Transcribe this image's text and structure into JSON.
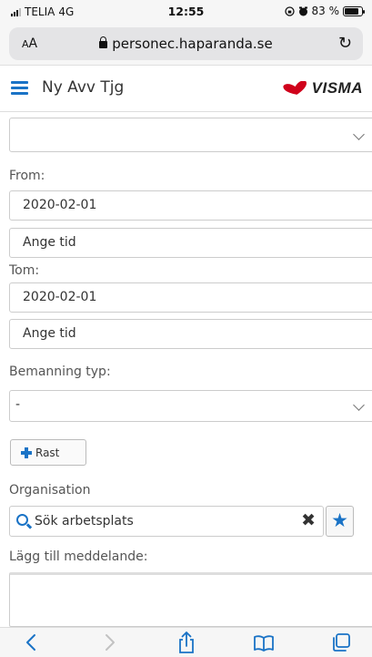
{
  "status_bar": {
    "carrier": "TELIA",
    "network": "4G",
    "time": "12:55",
    "battery_text": "83 %",
    "battery_level": 0.83
  },
  "browser": {
    "text_size_label_small": "A",
    "text_size_label_large": "A",
    "url": "personec.haparanda.se",
    "icons": [
      "lock-icon",
      "reload-icon",
      "back-icon",
      "forward-icon",
      "share-icon",
      "bookmarks-icon",
      "tabs-icon"
    ]
  },
  "header": {
    "title": "Ny Avv Tjg",
    "brand": "VISMA",
    "brand_color": "#d0021b",
    "accent_color": "#1a73c6"
  },
  "form": {
    "type_select_value": "",
    "from_label": "From:",
    "from_date": "2020-02-01",
    "from_time_placeholder": "Ange tid",
    "tom_label": "Tom:",
    "tom_date": "2020-02-01",
    "tom_time_placeholder": "Ange tid",
    "staffing_label": "Bemanning typ:",
    "staffing_value": "-",
    "break_button": "Rast",
    "org_label": "Organisation",
    "org_search_placeholder": "Sök arbetsplats",
    "message_label": "Lägg till meddelande:",
    "message_value": ""
  }
}
